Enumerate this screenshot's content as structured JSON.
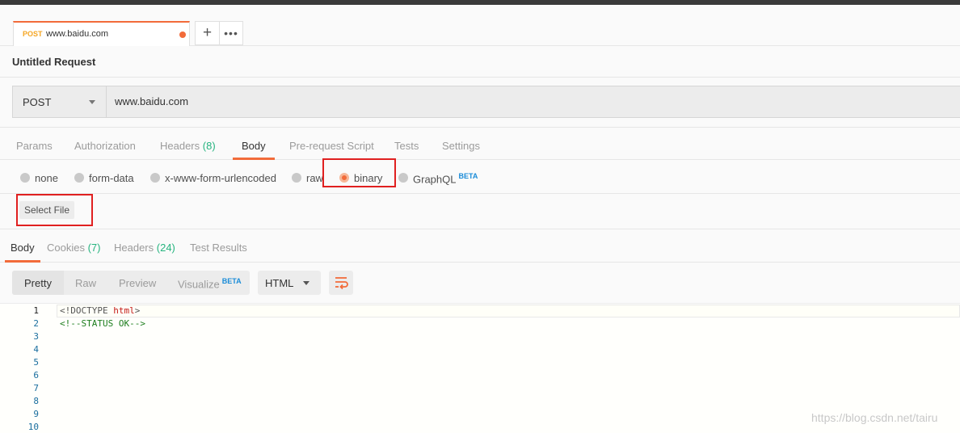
{
  "tab": {
    "method": "POST",
    "url": "www.baidu.com",
    "plus": "+",
    "more": "•••"
  },
  "request_title": "Untitled Request",
  "url_bar": {
    "method": "POST",
    "url": "www.baidu.com"
  },
  "request_tabs": {
    "params": "Params",
    "authorization": "Authorization",
    "headers": "Headers",
    "headers_count": "(8)",
    "body": "Body",
    "prerequest": "Pre-request Script",
    "tests": "Tests",
    "settings": "Settings"
  },
  "body_types": {
    "none": "none",
    "form_data": "form-data",
    "urlencoded": "x-www-form-urlencoded",
    "raw": "raw",
    "binary": "binary",
    "graphql": "GraphQL",
    "beta": "BETA",
    "selected": "binary"
  },
  "select_file": "Select File",
  "response_tabs": {
    "body": "Body",
    "cookies": "Cookies",
    "cookies_count": "(7)",
    "headers": "Headers",
    "headers_count": "(24)",
    "test_results": "Test Results"
  },
  "view_toolbar": {
    "pretty": "Pretty",
    "raw": "Raw",
    "preview": "Preview",
    "visualize": "Visualize",
    "beta": "BETA",
    "language": "HTML"
  },
  "code": {
    "line_numbers": [
      "1",
      "2",
      "3",
      "4",
      "5",
      "6",
      "7",
      "8",
      "9",
      "10"
    ],
    "line1_open": "<!DOCTYPE ",
    "line1_tag": "html",
    "line1_close": ">",
    "line2": "<!--STATUS OK-->"
  },
  "watermark": "https://blog.csdn.net/tairu",
  "colors": {
    "accent": "#f26b3a",
    "count_green": "#26b47f",
    "beta_blue": "#1a8cd8",
    "highlight_red": "#e02020"
  }
}
